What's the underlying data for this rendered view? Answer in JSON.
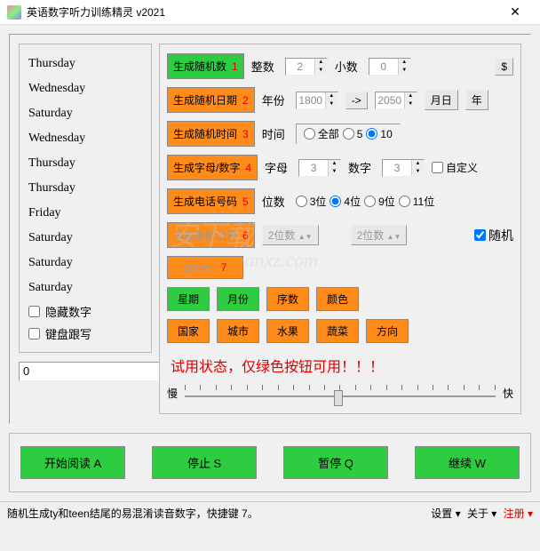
{
  "title": "英语数字听力训练精灵 v2021",
  "close": "✕",
  "days": [
    "Thursday",
    "Wednesday",
    "Saturday",
    "Wednesday",
    "Thursday",
    "Thursday",
    "Friday",
    "Saturday",
    "Saturday",
    "Saturday"
  ],
  "leftChecks": {
    "hide": "隐藏数字",
    "keyboard": "键盘跟写"
  },
  "plusInput": "0",
  "row1": {
    "btn": "生成随机数",
    "num": "1",
    "lbl1": "整数",
    "v1": "2",
    "lbl2": "小数",
    "v2": "0",
    "dollar": "$"
  },
  "row2": {
    "btn": "生成随机日期",
    "num": "2",
    "lbl": "年份",
    "from": "1800",
    "arrow": "->",
    "to": "2050",
    "md": "月日",
    "y": "年"
  },
  "row3": {
    "btn": "生成随机时间",
    "num": "3",
    "lbl": "时间",
    "opts": [
      "全部",
      "5",
      "10"
    ],
    "sel": 2
  },
  "row4": {
    "btn": "生成字母/数字",
    "num": "4",
    "lbl1": "字母",
    "v1": "3",
    "lbl2": "数字",
    "v2": "3",
    "custom": "自定义"
  },
  "row5": {
    "btn": "生成电话号码",
    "num": "5",
    "lbl": "位数",
    "opts": [
      "3位",
      "4位",
      "9位",
      "11位"
    ],
    "sel": 1
  },
  "row6": {
    "btn": "加减乘除运算",
    "num": "6",
    "opt1": "2位数",
    "opt2": "2位数",
    "rand": "随机"
  },
  "row7": {
    "btn": "ty/teen",
    "num": "7"
  },
  "catRow1": [
    "星期",
    "月份",
    "序数",
    "颜色"
  ],
  "catRow2": [
    "国家",
    "城市",
    "水果",
    "蔬菜",
    "方向"
  ],
  "trial": "试用状态，仅绿色按钮可用！！！",
  "slow": "慢",
  "fast": "快",
  "bottom": [
    "开始阅读 A",
    "停止 S",
    "暂停 Q",
    "继续 W"
  ],
  "status": {
    "left": "随机生成ty和teen结尾的易混淆读音数字，快捷键 7。",
    "settings": "设置 ▾",
    "about": "关于 ▾",
    "reg": "注册 ▾"
  },
  "watermark": "·anxz.com"
}
